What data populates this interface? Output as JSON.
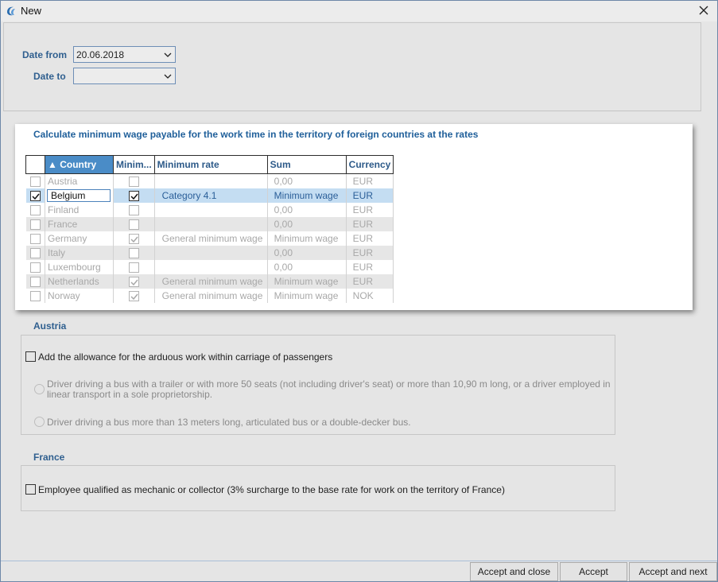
{
  "window": {
    "title": "New"
  },
  "filters": {
    "date_from_label": "Date from",
    "date_from_value": "20.06.2018",
    "date_to_label": "Date to",
    "date_to_value": ""
  },
  "popup": {
    "title": "Calculate minimum wage payable for the work time in the territory of foreign countries at the rates",
    "columns": [
      "▲ Country",
      "Minim...",
      "Minimum rate",
      "Sum",
      "Currency"
    ],
    "rows": [
      {
        "checked": false,
        "country": "Austria",
        "min_checked": false,
        "rate": "",
        "sum": "0,00",
        "currency": "EUR"
      },
      {
        "checked": true,
        "country": "Belgium",
        "min_checked": true,
        "rate": "Category 4.1",
        "sum": "Minimum wage",
        "currency": "EUR",
        "selected": true
      },
      {
        "checked": false,
        "country": "Finland",
        "min_checked": false,
        "rate": "",
        "sum": "0,00",
        "currency": "EUR"
      },
      {
        "checked": false,
        "country": "France",
        "min_checked": false,
        "rate": "",
        "sum": "0,00",
        "currency": "EUR"
      },
      {
        "checked": false,
        "country": "Germany",
        "min_checked": true,
        "rate": "General minimum wage",
        "sum": "Minimum wage",
        "currency": "EUR"
      },
      {
        "checked": false,
        "country": "Italy",
        "min_checked": false,
        "rate": "",
        "sum": "0,00",
        "currency": "EUR"
      },
      {
        "checked": false,
        "country": "Luxembourg",
        "min_checked": false,
        "rate": "",
        "sum": "0,00",
        "currency": "EUR"
      },
      {
        "checked": false,
        "country": "Netherlands",
        "min_checked": true,
        "rate": "General minimum wage",
        "sum": "Minimum wage",
        "currency": "EUR"
      },
      {
        "checked": false,
        "country": "Norway",
        "min_checked": true,
        "rate": "General minimum wage",
        "sum": "Minimum wage",
        "currency": "NOK"
      }
    ]
  },
  "austria": {
    "label": "Austria",
    "checkbox_label": "Add the allowance for the arduous work within carriage of passengers",
    "radio1_label_line1": "Driver driving a bus with a trailer or with more 50 seats (not including driver's seat) or more than 10,90 m long, or a driver employed in",
    "radio1_label_line2": "linear transport in a sole proprietorship.",
    "radio2_label": "Driver driving a bus more than 13 meters long, articulated bus or a double-decker bus."
  },
  "france": {
    "label": "France",
    "checkbox_label": "Employee qualified as mechanic or collector (3% surcharge to the base rate for work on the territory of France)"
  },
  "footer": {
    "accept_close": "Accept and close",
    "accept": "Accept",
    "accept_next": "Accept and next"
  },
  "colors": {
    "accent": "#4a8cc7",
    "label": "#2f5f8f",
    "selection": "#c4ddf2"
  }
}
